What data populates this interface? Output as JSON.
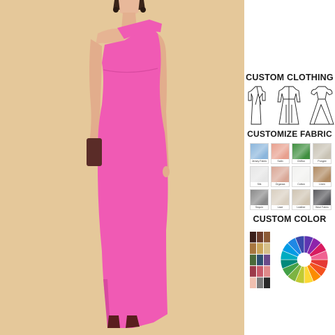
{
  "product": {
    "dress_color": "#f05ab4",
    "background_color": "#e5c89a",
    "clutch_color": "#5a2c28"
  },
  "headings": {
    "custom_clothing": "CUSTOM CLOTHING",
    "customize_fabric": "CUSTOMIZE FABRIC",
    "custom_color": "CUSTOM COLOR"
  },
  "fabrics": [
    {
      "label": "Jersey Fabric",
      "color": "#8bb6dc"
    },
    {
      "label": "Satin",
      "color": "#e8a08e"
    },
    {
      "label": "Chiffon",
      "color": "#3f8f3f"
    },
    {
      "label": "Pongee",
      "color": "#c8c2b4"
    },
    {
      "label": "Silk",
      "color": "#e6e6e6"
    },
    {
      "label": "Organza",
      "color": "#d9a796"
    },
    {
      "label": "Cotton",
      "color": "#f2f2f0"
    },
    {
      "label": "Linen",
      "color": "#b08a62"
    },
    {
      "label": "Sequin",
      "color": "#8a8a8a"
    },
    {
      "label": "Lace",
      "color": "#d9cfc0"
    },
    {
      "label": "Leather",
      "color": "#cfc4b2"
    },
    {
      "label": "Wool Fabric",
      "color": "#5a5a5e"
    }
  ],
  "thread_colors": [
    "#3b1f1a",
    "#6b3b2a",
    "#8c5a36",
    "#a7763f",
    "#c9a45a",
    "#d6c08a",
    "#4a6a3a",
    "#2f4f6f",
    "#6a4a8a",
    "#9c3a4a",
    "#c75a6a",
    "#e08a8a",
    "#f0c0b0",
    "#7a7a7a",
    "#2a2a2a"
  ],
  "wheel_colors": [
    "#e53935",
    "#f4511e",
    "#fb8c00",
    "#fdd835",
    "#c0ca33",
    "#7cb342",
    "#43a047",
    "#00897b",
    "#00acc1",
    "#039be5",
    "#1e88e5",
    "#3949ab",
    "#5e35b1",
    "#8e24aa",
    "#d81b60",
    "#f06292"
  ]
}
